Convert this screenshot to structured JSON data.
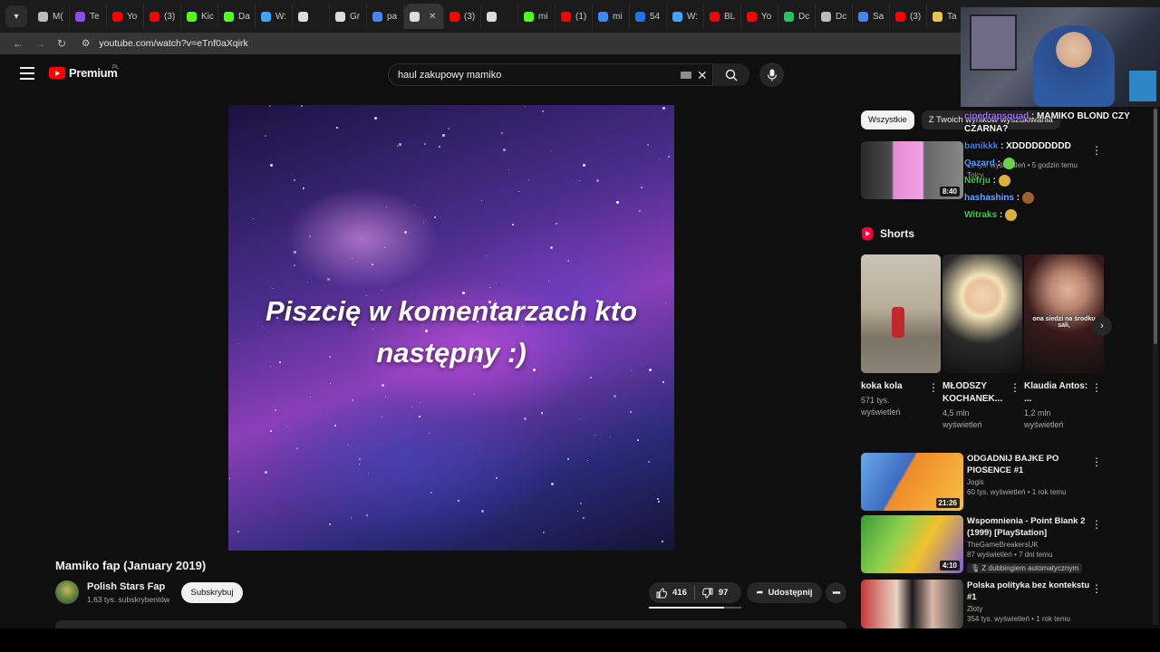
{
  "browser": {
    "tabs": [
      {
        "label": "M(",
        "color": "#bbbbbb"
      },
      {
        "label": "Te",
        "color": "#9146ff"
      },
      {
        "label": "Yo",
        "color": "#ff0000"
      },
      {
        "label": "(3)",
        "color": "#ff0000"
      },
      {
        "label": "Kic",
        "color": "#53fc18"
      },
      {
        "label": "Da",
        "color": "#53fc18"
      },
      {
        "label": "W:",
        "color": "#3ea6ff"
      },
      {
        "label": "",
        "color": "#dddddd"
      },
      {
        "label": "Gr",
        "color": "#dddddd"
      },
      {
        "label": "pa",
        "color": "#4285f4"
      },
      {
        "label": "",
        "color": "#dddddd",
        "active": true
      },
      {
        "label": "(3)",
        "color": "#ff0000"
      },
      {
        "label": "",
        "color": "#dddddd"
      },
      {
        "label": "mi",
        "color": "#53fc18"
      },
      {
        "label": "(1)",
        "color": "#ff0000"
      },
      {
        "label": "mi",
        "color": "#4285f4"
      },
      {
        "label": "54",
        "color": "#1877f2"
      },
      {
        "label": "W:",
        "color": "#3ea6ff"
      },
      {
        "label": "BL",
        "color": "#ff0000"
      },
      {
        "label": "Yo",
        "color": "#ff0000"
      },
      {
        "label": "Dc",
        "color": "#22c55e"
      },
      {
        "label": "Dc",
        "color": "#bbbbbb"
      },
      {
        "label": "Sa",
        "color": "#4285f4"
      },
      {
        "label": "(3)",
        "color": "#ff0000"
      },
      {
        "label": "Ta",
        "color": "#e8c547"
      }
    ],
    "url": "youtube.com/watch?v=eTnf0aXqirk"
  },
  "header": {
    "logo_text": "Premium",
    "logo_region": "PL",
    "search_value": "haul zakupowy mamiko"
  },
  "player": {
    "caption_line1": "Piszcię w komentarzach kto",
    "caption_line2": "następny :)"
  },
  "video": {
    "title": "Mamiko fap (January 2019)",
    "channel": "Polish Stars Fap",
    "subscribers": "1,63 tys. subskrybentów",
    "subscribe_label": "Subskrybuj",
    "likes": "416",
    "dislikes": "97",
    "like_ratio": 0.81,
    "share_label": "Udostępnij"
  },
  "chips": [
    "Wszystkie",
    "Z Twoich wyników wyszukiwania"
  ],
  "recommendations": [
    {
      "title": "",
      "channel": "Tojcy",
      "meta": "28 tys. wyświetleń • 5 godzin temu",
      "duration": "8:40",
      "badge": ""
    },
    {
      "title": "ODGADNIJ BAJKE PO PIOSENCE #1",
      "channel": "Jogis",
      "meta": "60 tys. wyświetleń • 1 rok temu",
      "duration": "21:26",
      "badge": ""
    },
    {
      "title": "Wspomnienia - Point Blank 2 (1999) [PlayStation]",
      "channel": "TheGameBreakersUK",
      "meta": "87 wyświetleń • 7 dni temu",
      "duration": "4:10",
      "badge": "Z dubbingiem automatycznym"
    },
    {
      "title": "Polska polityka bez kontekstu #1",
      "channel": "Złoty",
      "meta": "354 tys. wyświetleń • 1 rok temu",
      "duration": "",
      "badge": ""
    }
  ],
  "shorts": {
    "heading": "Shorts",
    "items": [
      {
        "title": "koka kola",
        "views": "571 tys. wyświetleń"
      },
      {
        "title": "MŁODSZY KOCHANEK...",
        "views": "4,5 mln wyświetleń"
      },
      {
        "title": "Klaudia Antos: ...",
        "views": "1,2 mln wyświetleń"
      }
    ],
    "third_overlay": "ona siedzi na środku sali,"
  },
  "chat": [
    {
      "user": "cipedrapsquad",
      "message": "MAMIKO BLOND CZY CZARNA?",
      "color": "#a970ff"
    },
    {
      "user": "banikkk",
      "message": "XDDDDDDDDD",
      "color": "#3b82f6"
    },
    {
      "user": "Qazard",
      "message": "",
      "color": "#5b9bff"
    },
    {
      "user": "Nefrju",
      "message": "",
      "color": "#35d048"
    },
    {
      "user": "hashashins",
      "message": "",
      "color": "#6fa8ff"
    },
    {
      "user": "Witraks",
      "message": "",
      "color": "#35d048"
    }
  ]
}
